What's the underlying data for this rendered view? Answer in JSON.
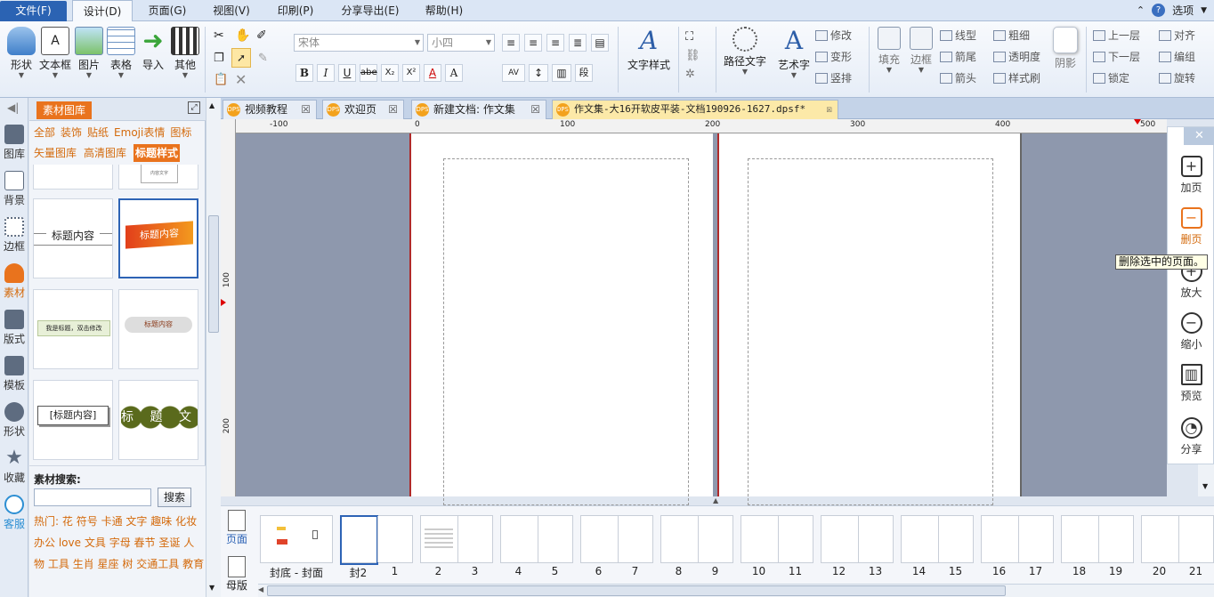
{
  "menu": {
    "file": "文件(F)",
    "items": [
      "设计(D)",
      "页面(G)",
      "视图(V)",
      "印刷(P)",
      "分享导出(E)",
      "帮助(H)"
    ],
    "options": "选项"
  },
  "ribbon": {
    "insert_buttons": [
      "形状",
      "文本框",
      "图片",
      "表格",
      "导入",
      "其他"
    ],
    "font_name": "宋体",
    "font_size": "小四",
    "text_style": "文字样式",
    "path_text": "路径文字",
    "art_text": "艺术字",
    "art_small": [
      "修改",
      "变形",
      "竖排"
    ],
    "fill": "填充",
    "border": "边框",
    "line_opts": [
      "线型",
      "箭尾",
      "箭头"
    ],
    "line_opts2": [
      "粗细",
      "透明度",
      "样式刷"
    ],
    "shadow": "阴影",
    "arrange": [
      "上一层",
      "下一层",
      "锁定"
    ],
    "arrange2": [
      "对齐",
      "编组",
      "旋转"
    ]
  },
  "left_strip": [
    "图库",
    "背景",
    "边框",
    "素材",
    "版式",
    "模板",
    "形状",
    "收藏",
    "客服"
  ],
  "panel": {
    "title": "素材图库",
    "categories_row1": [
      "全部",
      "装饰",
      "贴纸",
      "Emoji表情",
      "图标"
    ],
    "categories_row2": [
      "矢量图库",
      "高清图库",
      "标题样式"
    ],
    "thumb_texts": [
      "标题内容",
      "标题内容",
      "我是标题，双击修改",
      "标题内容",
      "[标题内容]",
      "标 题 文 字",
      "内容文字"
    ],
    "search_label": "素材搜索:",
    "search_button": "搜索",
    "hot_label": "热门:",
    "tags": [
      "花",
      "符号",
      "卡通",
      "文字",
      "趣味",
      "化妆",
      "办公",
      "love",
      "文具",
      "字母",
      "春节",
      "圣诞",
      "人物",
      "工具",
      "生肖",
      "星座",
      "树",
      "交通工具",
      "教育"
    ]
  },
  "tabs": [
    {
      "label": "视频教程"
    },
    {
      "label": "欢迎页"
    },
    {
      "label": "新建文档: 作文集"
    },
    {
      "label": "作文集-大16开软皮平装-文档190926-1627.dpsf*"
    }
  ],
  "ruler": {
    "h": [
      "-100",
      "0",
      "100",
      "200",
      "300",
      "400",
      "500"
    ],
    "v": [
      "100",
      "200"
    ]
  },
  "right_panel": [
    "加页",
    "删页",
    "放大",
    "缩小",
    "预览",
    "分享"
  ],
  "tooltip": "删除选中的页面。",
  "page_strip": {
    "side": [
      "页面",
      "母版"
    ],
    "labels": [
      "封底 - 封面",
      "封2",
      "1",
      "2",
      "3",
      "4",
      "5",
      "6",
      "7",
      "8",
      "9",
      "10",
      "11",
      "12",
      "13",
      "14",
      "15",
      "16",
      "17",
      "18",
      "19",
      "20",
      "21"
    ]
  },
  "colors": {
    "accent": "#e9731d",
    "menu_file": "#2b63b3",
    "canvas_bg": "#8e98ad",
    "tab_active": "#fce9a8"
  }
}
